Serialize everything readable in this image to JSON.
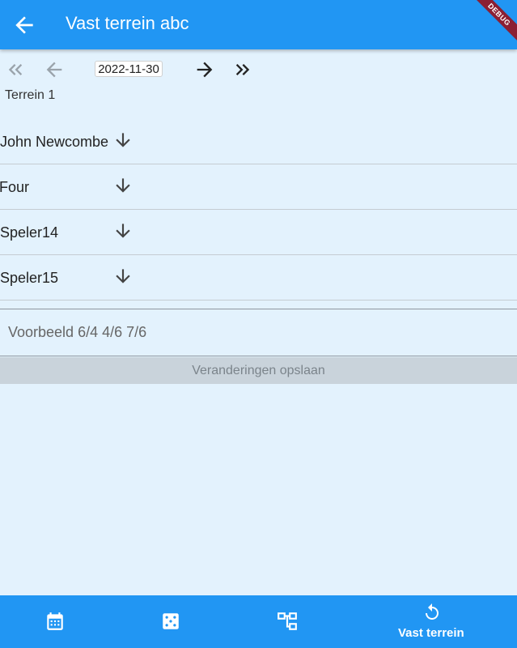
{
  "app_bar": {
    "title": "Vast terrein abc",
    "debug_banner": "DEBUG"
  },
  "date_bar": {
    "date": "2022-11-30"
  },
  "terrain": {
    "label": "Terrein 1"
  },
  "players": [
    {
      "name": "John Newcombe"
    },
    {
      "name": "t Four"
    },
    {
      "name": "Speler14"
    },
    {
      "name": "Speler15"
    }
  ],
  "score": {
    "placeholder": "Voorbeeld 6/4 4/6 7/6"
  },
  "save_button": {
    "label": "Veranderingen opslaan"
  },
  "bottom_nav": {
    "items": [
      {
        "icon": "calendar-icon",
        "label": ""
      },
      {
        "icon": "dice-icon",
        "label": ""
      },
      {
        "icon": "tournament-bracket-icon",
        "label": ""
      },
      {
        "icon": "rotate-icon",
        "label": "Vast terrein"
      }
    ]
  },
  "colors": {
    "primary": "#2196f3",
    "background": "#e3f2fd",
    "debug_ribbon": "#8b1f33"
  }
}
